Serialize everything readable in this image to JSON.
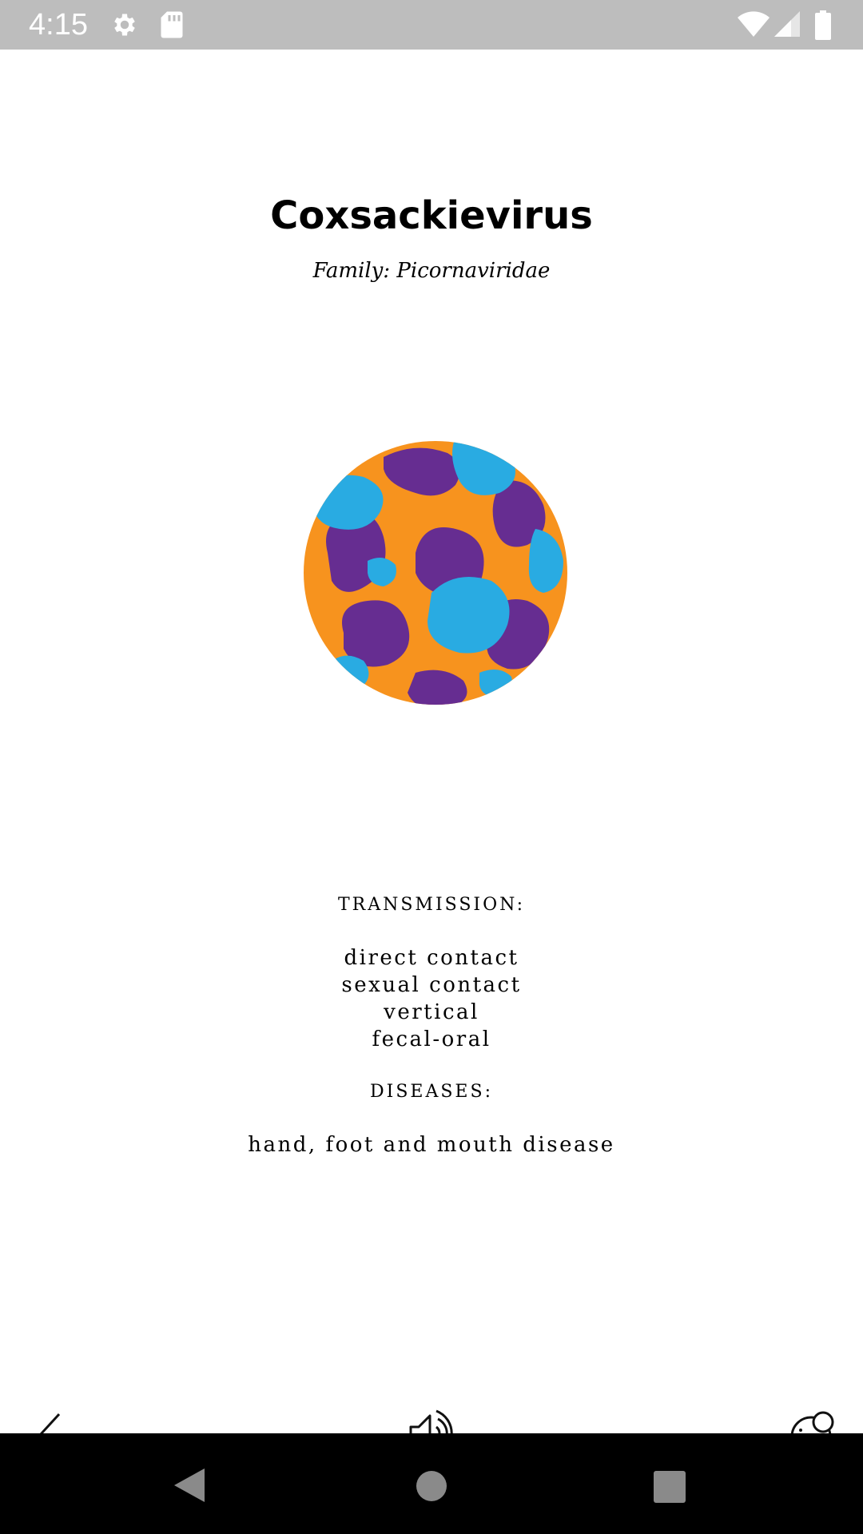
{
  "status_bar": {
    "time": "4:15",
    "icons": [
      "settings-icon",
      "sd-card-icon",
      "wifi-icon",
      "cell-signal-icon",
      "battery-icon"
    ]
  },
  "virus": {
    "name": "Coxsackievirus",
    "family": "Family: Picornaviridae",
    "illustration": "virus-capsid-illustration",
    "colors": {
      "orange": "#f7931e",
      "blue": "#29abe2",
      "purple": "#662d91"
    }
  },
  "transmission": {
    "heading": "TRANSMISSION:",
    "items": [
      "direct contact",
      "sexual contact",
      "vertical",
      "fecal-oral"
    ]
  },
  "diseases": {
    "heading": "DISEASES:",
    "items": [
      "hand, foot and mouth disease"
    ]
  },
  "toolbar": {
    "back": "chevron-left-icon",
    "audio": "speaker-icon",
    "explore": "cells-icon"
  },
  "nav_bar": {
    "buttons": [
      "back-triangle-icon",
      "home-circle-icon",
      "recents-square-icon"
    ]
  }
}
